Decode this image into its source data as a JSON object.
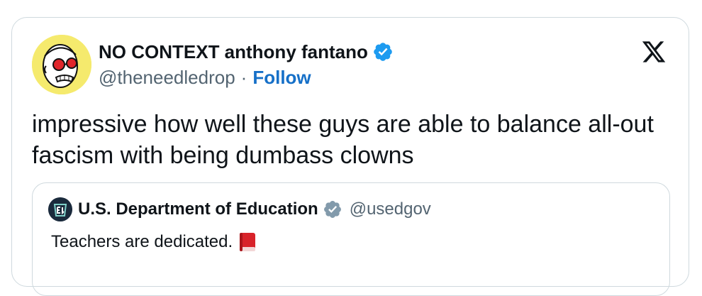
{
  "author": {
    "display_name": "NO CONTEXT anthony fantano",
    "handle": "@theneedledrop",
    "separator": "·",
    "follow_label": "Follow",
    "verified_color": "#1d9bf0",
    "avatar_bg": "#f5ea6d"
  },
  "tweet": {
    "text": "impressive how well these guys are able to balance all-out fascism with being dumbass clowns"
  },
  "quoted_tweet": {
    "display_name": "U.S. Department of Education",
    "handle": "@usedgov",
    "verified_color": "#829aab",
    "text": "Teachers are dedicated.",
    "emoji_icon": "red-book-icon"
  },
  "icons": {
    "brand": "x-logo-icon",
    "verified": "verified-badge-icon"
  },
  "colors": {
    "border": "#cfd9de",
    "secondary_text": "#536471",
    "link": "#1670c8"
  }
}
